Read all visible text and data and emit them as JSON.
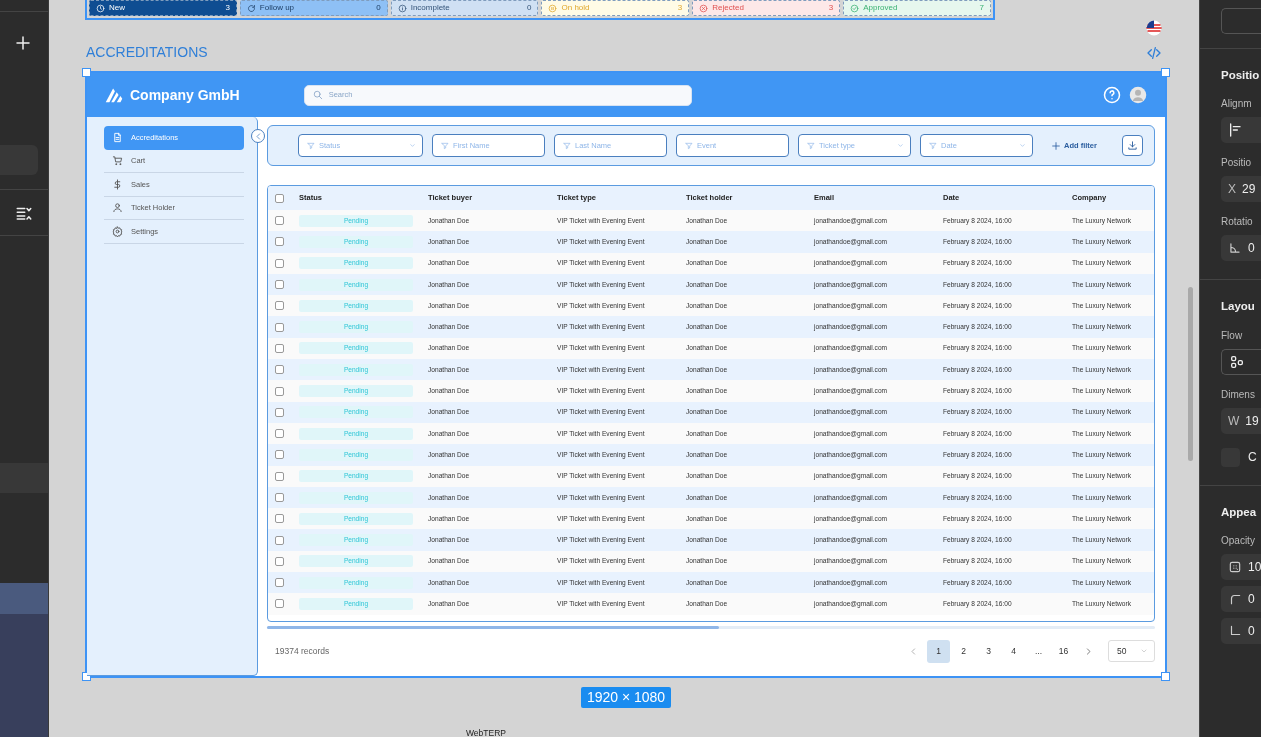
{
  "status_cards": [
    {
      "label": "New",
      "count": "3",
      "kind": "clock",
      "color": "#0f4d92"
    },
    {
      "label": "Follow up",
      "count": "0",
      "kind": "refresh",
      "color": "#8ec0f5"
    },
    {
      "label": "Incomplete",
      "count": "0",
      "kind": "info",
      "color": "#cfe0f3"
    },
    {
      "label": "On hold",
      "count": "3",
      "kind": "pause",
      "color": "#fffbe6"
    },
    {
      "label": "Rejected",
      "count": "3",
      "kind": "cross",
      "color": "#fde8e8"
    },
    {
      "label": "Approved",
      "count": "7",
      "kind": "check",
      "color": "#e6f7ee"
    }
  ],
  "section_title": "ACCREDITATIONS",
  "app": {
    "brand": "Company GmbH",
    "search": {
      "placeholder": "Search"
    },
    "sidebar": [
      {
        "label": "Accreditations",
        "kind": "document",
        "selected": true
      },
      {
        "label": "Cart",
        "kind": "cart",
        "selected": false
      },
      {
        "label": "Sales",
        "kind": "dollar",
        "selected": false
      },
      {
        "label": "Ticket Holder",
        "kind": "user",
        "selected": false
      },
      {
        "label": "Settings",
        "kind": "gear",
        "selected": false
      }
    ],
    "filters": [
      {
        "placeholder": "Status",
        "dropdown": true
      },
      {
        "placeholder": "First Name",
        "dropdown": false
      },
      {
        "placeholder": "Last Name",
        "dropdown": false
      },
      {
        "placeholder": "Event",
        "dropdown": false
      },
      {
        "placeholder": "Ticket type",
        "dropdown": true
      },
      {
        "placeholder": "Date",
        "dropdown": true
      }
    ],
    "add_filter": "Add filter",
    "table": {
      "header_checked": false,
      "columns": [
        "Status",
        "Ticket buyer",
        "Ticket type",
        "Ticket holder",
        "Email",
        "Date",
        "Company"
      ],
      "rows": [
        {
          "checked": false,
          "cells": [
            "Pending",
            "Jonathan Doe",
            "VIP Ticket with Evening Event",
            "Jonathan Doe",
            "jonathandoe@gmail.com",
            "February 8 2024, 16:00",
            "The Luxury Network"
          ]
        },
        {
          "checked": false,
          "cells": [
            "Pending",
            "Jonathan Doe",
            "VIP Ticket with Evening Event",
            "Jonathan Doe",
            "jonathandoe@gmail.com",
            "February 8 2024, 16:00",
            "The Luxury Network"
          ]
        },
        {
          "checked": false,
          "cells": [
            "Pending",
            "Jonathan Doe",
            "VIP Ticket with Evening Event",
            "Jonathan Doe",
            "jonathandoe@gmail.com",
            "February 8 2024, 16:00",
            "The Luxury Network"
          ]
        },
        {
          "checked": false,
          "cells": [
            "Pending",
            "Jonathan Doe",
            "VIP Ticket with Evening Event",
            "Jonathan Doe",
            "jonathandoe@gmail.com",
            "February 8 2024, 16:00",
            "The Luxury Network"
          ]
        },
        {
          "checked": false,
          "cells": [
            "Pending",
            "Jonathan Doe",
            "VIP Ticket with Evening Event",
            "Jonathan Doe",
            "jonathandoe@gmail.com",
            "February 8 2024, 16:00",
            "The Luxury Network"
          ]
        },
        {
          "checked": false,
          "cells": [
            "Pending",
            "Jonathan Doe",
            "VIP Ticket with Evening Event",
            "Jonathan Doe",
            "jonathandoe@gmail.com",
            "February 8 2024, 16:00",
            "The Luxury Network"
          ]
        },
        {
          "checked": false,
          "cells": [
            "Pending",
            "Jonathan Doe",
            "VIP Ticket with Evening Event",
            "Jonathan Doe",
            "jonathandoe@gmail.com",
            "February 8 2024, 16:00",
            "The Luxury Network"
          ]
        },
        {
          "checked": false,
          "cells": [
            "Pending",
            "Jonathan Doe",
            "VIP Ticket with Evening Event",
            "Jonathan Doe",
            "jonathandoe@gmail.com",
            "February 8 2024, 16:00",
            "The Luxury Network"
          ]
        },
        {
          "checked": false,
          "cells": [
            "Pending",
            "Jonathan Doe",
            "VIP Ticket with Evening Event",
            "Jonathan Doe",
            "jonathandoe@gmail.com",
            "February 8 2024, 16:00",
            "The Luxury Network"
          ]
        },
        {
          "checked": false,
          "cells": [
            "Pending",
            "Jonathan Doe",
            "VIP Ticket with Evening Event",
            "Jonathan Doe",
            "jonathandoe@gmail.com",
            "February 8 2024, 16:00",
            "The Luxury Network"
          ]
        },
        {
          "checked": false,
          "cells": [
            "Pending",
            "Jonathan Doe",
            "VIP Ticket with Evening Event",
            "Jonathan Doe",
            "jonathandoe@gmail.com",
            "February 8 2024, 16:00",
            "The Luxury Network"
          ]
        },
        {
          "checked": false,
          "cells": [
            "Pending",
            "Jonathan Doe",
            "VIP Ticket with Evening Event",
            "Jonathan Doe",
            "jonathandoe@gmail.com",
            "February 8 2024, 16:00",
            "The Luxury Network"
          ]
        },
        {
          "checked": false,
          "cells": [
            "Pending",
            "Jonathan Doe",
            "VIP Ticket with Evening Event",
            "Jonathan Doe",
            "jonathandoe@gmail.com",
            "February 8 2024, 16:00",
            "The Luxury Network"
          ]
        },
        {
          "checked": false,
          "cells": [
            "Pending",
            "Jonathan Doe",
            "VIP Ticket with Evening Event",
            "Jonathan Doe",
            "jonathandoe@gmail.com",
            "February 8 2024, 16:00",
            "The Luxury Network"
          ]
        },
        {
          "checked": false,
          "cells": [
            "Pending",
            "Jonathan Doe",
            "VIP Ticket with Evening Event",
            "Jonathan Doe",
            "jonathandoe@gmail.com",
            "February 8 2024, 16:00",
            "The Luxury Network"
          ]
        },
        {
          "checked": false,
          "cells": [
            "Pending",
            "Jonathan Doe",
            "VIP Ticket with Evening Event",
            "Jonathan Doe",
            "jonathandoe@gmail.com",
            "February 8 2024, 16:00",
            "The Luxury Network"
          ]
        },
        {
          "checked": false,
          "cells": [
            "Pending",
            "Jonathan Doe",
            "VIP Ticket with Evening Event",
            "Jonathan Doe",
            "jonathandoe@gmail.com",
            "February 8 2024, 16:00",
            "The Luxury Network"
          ]
        },
        {
          "checked": false,
          "cells": [
            "Pending",
            "Jonathan Doe",
            "VIP Ticket with Evening Event",
            "Jonathan Doe",
            "jonathandoe@gmail.com",
            "February 8 2024, 16:00",
            "The Luxury Network"
          ]
        },
        {
          "checked": false,
          "cells": [
            "Pending",
            "Jonathan Doe",
            "VIP Ticket with Evening Event",
            "Jonathan Doe",
            "jonathandoe@gmail.com",
            "February 8 2024, 16:00",
            "The Luxury Network"
          ]
        }
      ]
    },
    "records": "19374 records",
    "pages": [
      {
        "label": "1",
        "selected": true
      },
      {
        "label": "2",
        "selected": false
      },
      {
        "label": "3",
        "selected": false
      },
      {
        "label": "4",
        "selected": false
      },
      {
        "label": "...",
        "selected": false
      },
      {
        "label": "16",
        "selected": false
      }
    ],
    "page_size": "50"
  },
  "frame_size": "1920 × 1080",
  "caption": "WebTERP",
  "inspector": [
    {
      "kind": "heading",
      "text": "Positio"
    },
    {
      "kind": "label",
      "text": "Alignm"
    },
    {
      "kind": "align"
    },
    {
      "kind": "label",
      "text": "Positio"
    },
    {
      "kind": "field",
      "prefix": "X",
      "value": "29"
    },
    {
      "kind": "label",
      "text": "Rotatio"
    },
    {
      "kind": "angle",
      "value": "0"
    },
    {
      "kind": "divider"
    },
    {
      "kind": "heading",
      "text": "Layou"
    },
    {
      "kind": "label",
      "text": "Flow"
    },
    {
      "kind": "flow"
    },
    {
      "kind": "label",
      "text": "Dimens"
    },
    {
      "kind": "field",
      "prefix": "W",
      "value": "19"
    },
    {
      "kind": "checkbox",
      "text": "C",
      "checked": false
    },
    {
      "kind": "divider"
    },
    {
      "kind": "heading",
      "text": "Appea"
    },
    {
      "kind": "label",
      "text": "Opacity"
    },
    {
      "kind": "opacity",
      "value": "10"
    },
    {
      "kind": "corner",
      "value": "0"
    },
    {
      "kind": "corner2",
      "value": "0"
    }
  ]
}
